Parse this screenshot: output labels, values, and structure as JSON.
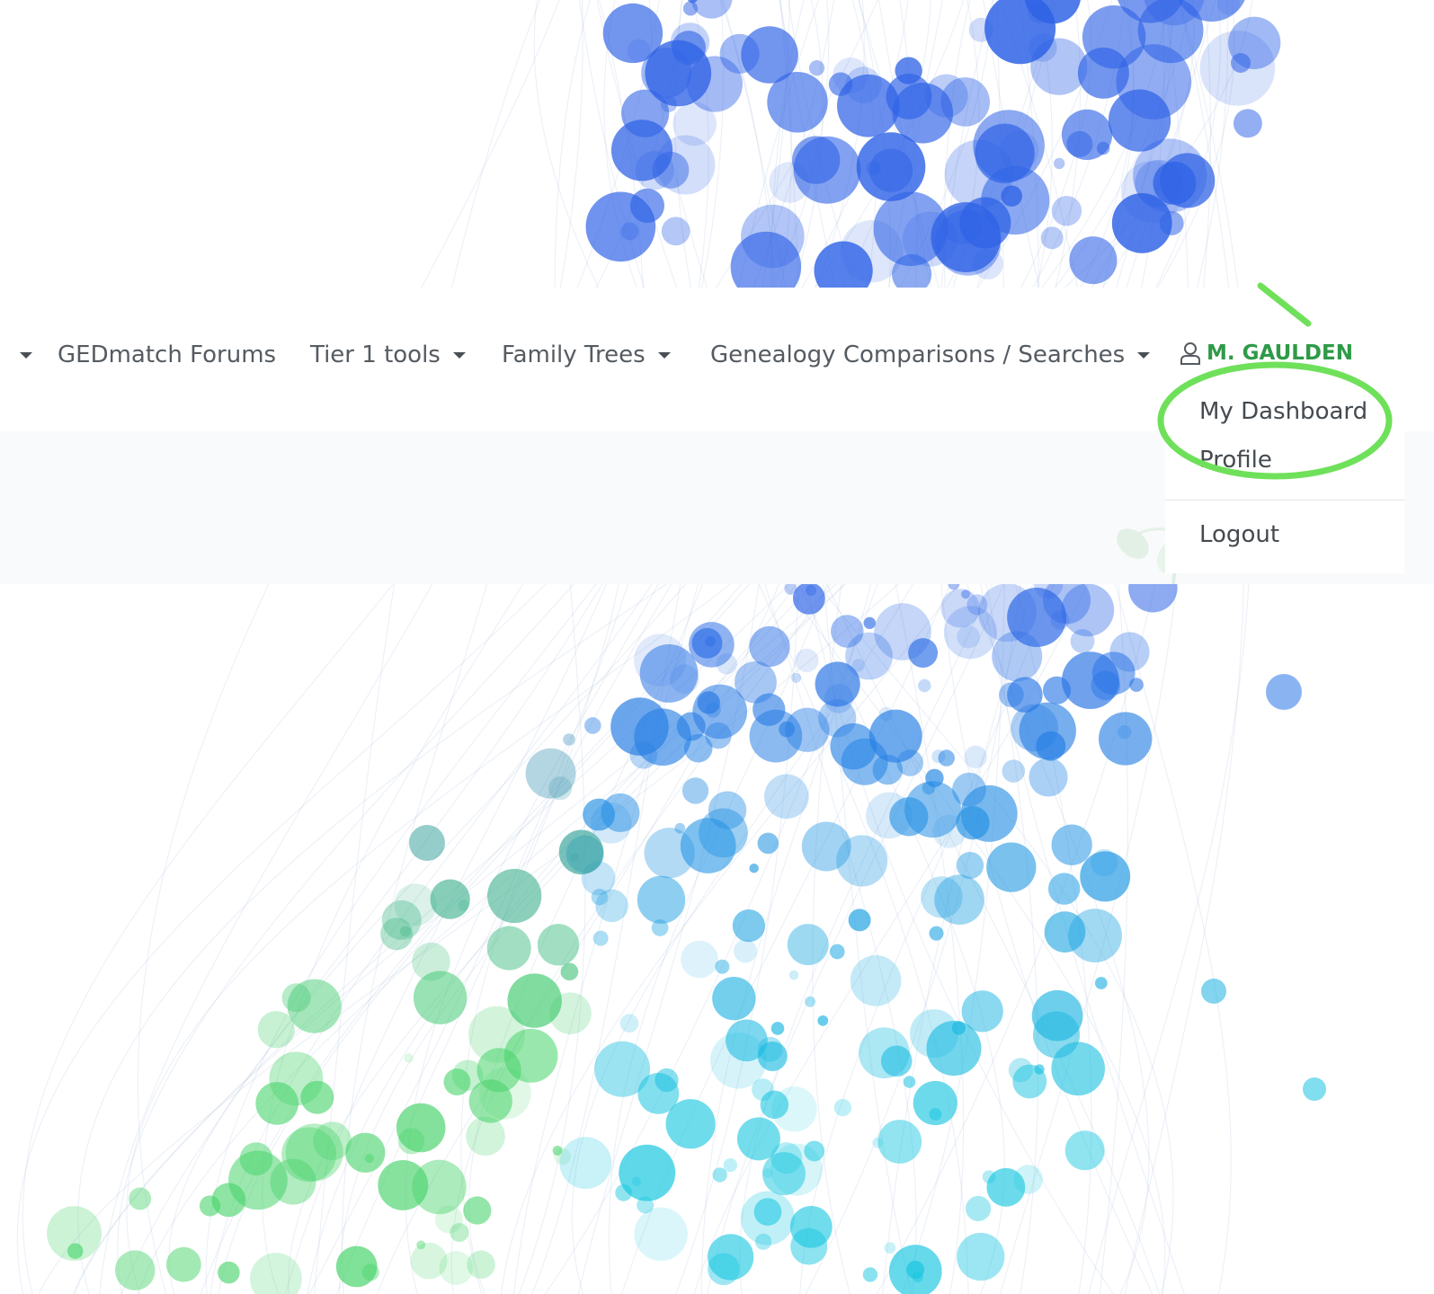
{
  "nav": {
    "items": [
      {
        "label": "",
        "has_caret": true
      },
      {
        "label": "GEDmatch Forums",
        "has_caret": false
      },
      {
        "label": "Tier 1 tools",
        "has_caret": true
      },
      {
        "label": "Family Trees",
        "has_caret": true
      },
      {
        "label": "Genealogy Comparisons / Searches",
        "has_caret": true
      }
    ],
    "user": {
      "name": "M. GAULDEN",
      "icon": "user-icon"
    }
  },
  "user_dropdown": {
    "items": [
      {
        "label": "My Dashboard"
      },
      {
        "label": "Profile"
      },
      {
        "label": "Logout"
      }
    ]
  },
  "annotation": {
    "target": "My Dashboard",
    "color": "#6fe05a"
  },
  "colors": {
    "nav_text": "#555b61",
    "user_accent": "#2f9a48",
    "bubble_blue": "#2f63e6",
    "bubble_cyan": "#17c6e0",
    "bubble_green": "#47d36a",
    "hero_band": "#f9fafb"
  }
}
